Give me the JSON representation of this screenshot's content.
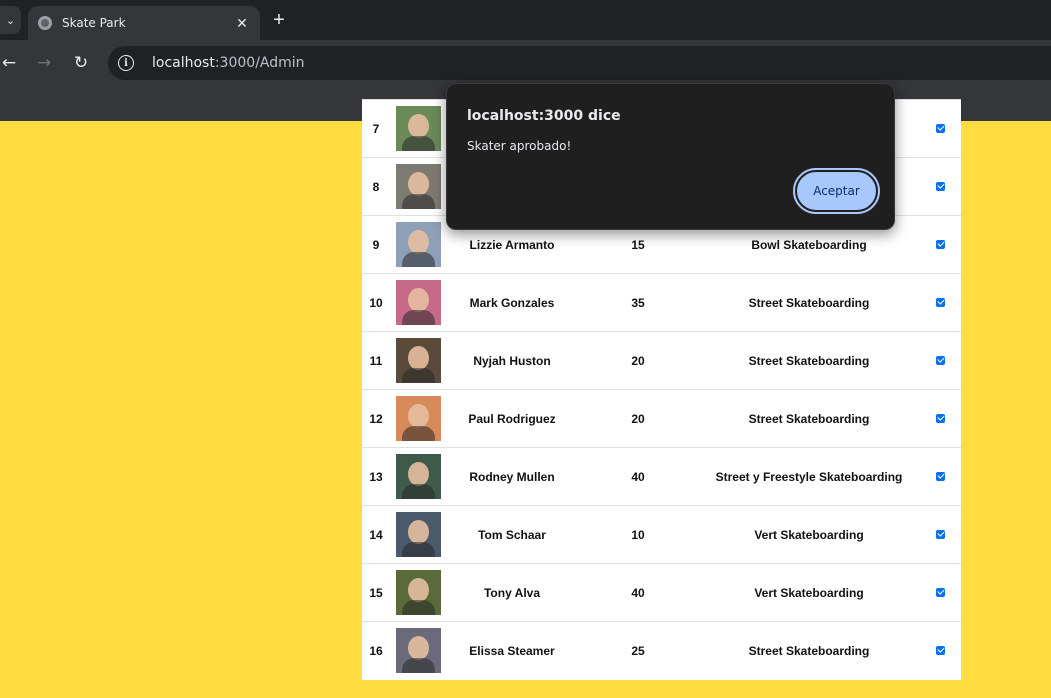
{
  "browser": {
    "tab_menu_icon": "chevron-down-icon",
    "tab_title": "Skate Park",
    "tab_close": "✕",
    "new_tab": "+",
    "url_host": "localhost",
    "url_path": ":3000/Admin",
    "back": "←",
    "forward": "→",
    "reload": "↻"
  },
  "dialog": {
    "origin": "localhost:3000 dice",
    "message": "Skater aprobado!",
    "ok_label": "Aceptar"
  },
  "skaters": [
    {
      "id": "7",
      "name": "",
      "years": "",
      "specialty": "",
      "approved": true,
      "photo_color": "#6a8a5a"
    },
    {
      "id": "8",
      "name": "",
      "years": "",
      "specialty": "",
      "approved": true,
      "photo_color": "#7d7a72"
    },
    {
      "id": "9",
      "name": "Lizzie Armanto",
      "years": "15",
      "specialty": "Bowl Skateboarding",
      "approved": true,
      "photo_color": "#8ea0b8"
    },
    {
      "id": "10",
      "name": "Mark Gonzales",
      "years": "35",
      "specialty": "Street Skateboarding",
      "approved": true,
      "photo_color": "#c76a8a"
    },
    {
      "id": "11",
      "name": "Nyjah Huston",
      "years": "20",
      "specialty": "Street Skateboarding",
      "approved": true,
      "photo_color": "#5a4a3a"
    },
    {
      "id": "12",
      "name": "Paul Rodriguez",
      "years": "20",
      "specialty": "Street Skateboarding",
      "approved": true,
      "photo_color": "#d98a5a"
    },
    {
      "id": "13",
      "name": "Rodney Mullen",
      "years": "40",
      "specialty": "Street y Freestyle Skateboarding",
      "approved": true,
      "photo_color": "#3e5a4a"
    },
    {
      "id": "14",
      "name": "Tom Schaar",
      "years": "10",
      "specialty": "Vert Skateboarding",
      "approved": true,
      "photo_color": "#4a5a6a"
    },
    {
      "id": "15",
      "name": "Tony Alva",
      "years": "40",
      "specialty": "Vert Skateboarding",
      "approved": true,
      "photo_color": "#5a6a3a"
    },
    {
      "id": "16",
      "name": "Elissa Steamer",
      "years": "25",
      "specialty": "Street Skateboarding",
      "approved": true,
      "photo_color": "#6a6a7a"
    }
  ]
}
